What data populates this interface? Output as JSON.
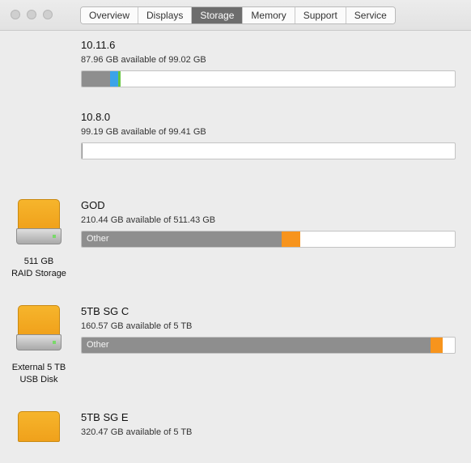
{
  "window": {
    "tabs": [
      {
        "label": "Overview"
      },
      {
        "label": "Displays"
      },
      {
        "label": "Storage",
        "active": true
      },
      {
        "label": "Memory"
      },
      {
        "label": "Support"
      },
      {
        "label": "Service"
      }
    ]
  },
  "volumes": [
    {
      "name": "10.11.6",
      "available": "87.96 GB available of 99.02 GB",
      "segments": [
        {
          "fraction": 0.077,
          "color": "#8e8e8e"
        },
        {
          "fraction": 0.02,
          "color": "#3ba3e8"
        },
        {
          "fraction": 0.008,
          "color": "#65c63f"
        }
      ]
    },
    {
      "name": "10.8.0",
      "available": "99.19 GB available of 99.41 GB",
      "segments": [
        {
          "fraction": 0.002,
          "color": "#8e8e8e"
        }
      ]
    },
    {
      "name": "GOD",
      "available": "210.44 GB available of 511.43 GB",
      "bar_label": "Other",
      "segments": [
        {
          "fraction": 0.535,
          "color": "#8e8e8e"
        },
        {
          "fraction": 0.05,
          "color": "#f7941d"
        }
      ],
      "drive": {
        "line1": "511 GB",
        "line2": "RAID Storage"
      }
    },
    {
      "name": "5TB SG C",
      "available": "160.57 GB available of 5 TB",
      "bar_label": "Other",
      "segments": [
        {
          "fraction": 0.935,
          "color": "#8e8e8e"
        },
        {
          "fraction": 0.032,
          "color": "#f7941d"
        }
      ],
      "drive": {
        "line1": "External 5 TB",
        "line2": "USB Disk"
      }
    },
    {
      "name": "5TB SG E",
      "available": "320.47 GB available of 5 TB",
      "drive": {
        "line1": "",
        "line2": ""
      }
    }
  ],
  "icons": {
    "drive": "external-drive-icon",
    "traffic_lights": [
      "close-icon",
      "minimize-icon",
      "zoom-icon"
    ]
  }
}
